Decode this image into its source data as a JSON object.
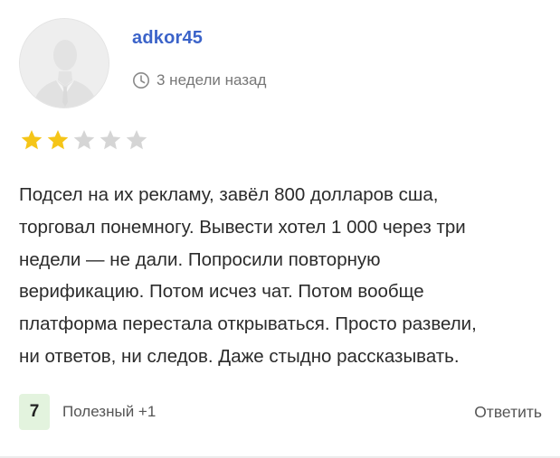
{
  "review": {
    "username": "adkor45",
    "time_ago": "3 недели назад",
    "rating": 2,
    "max_rating": 5,
    "text": "Подсел на их рекламу, завёл 800 долларов сша,\nторговал понемногу. Вывести хотел 1 000 через три\nнедели — не дали. Попросили повторную\nверификацию. Потом исчез чат. Потом вообще\nплатформа перестала открываться. Просто развели,\nни ответов, ни следов. Даже стыдно рассказывать."
  },
  "footer": {
    "score": "7",
    "helpful_label": "Полезный +1",
    "reply_label": "Ответить"
  },
  "colors": {
    "accent": "#3b63c9",
    "star_filled": "#f5c518",
    "star_empty": "#d5d5d5",
    "score_bg": "#e3f3de"
  },
  "icons": {
    "avatar": "default-user-silhouette",
    "time": "clock-icon",
    "rating": "star-icon"
  }
}
